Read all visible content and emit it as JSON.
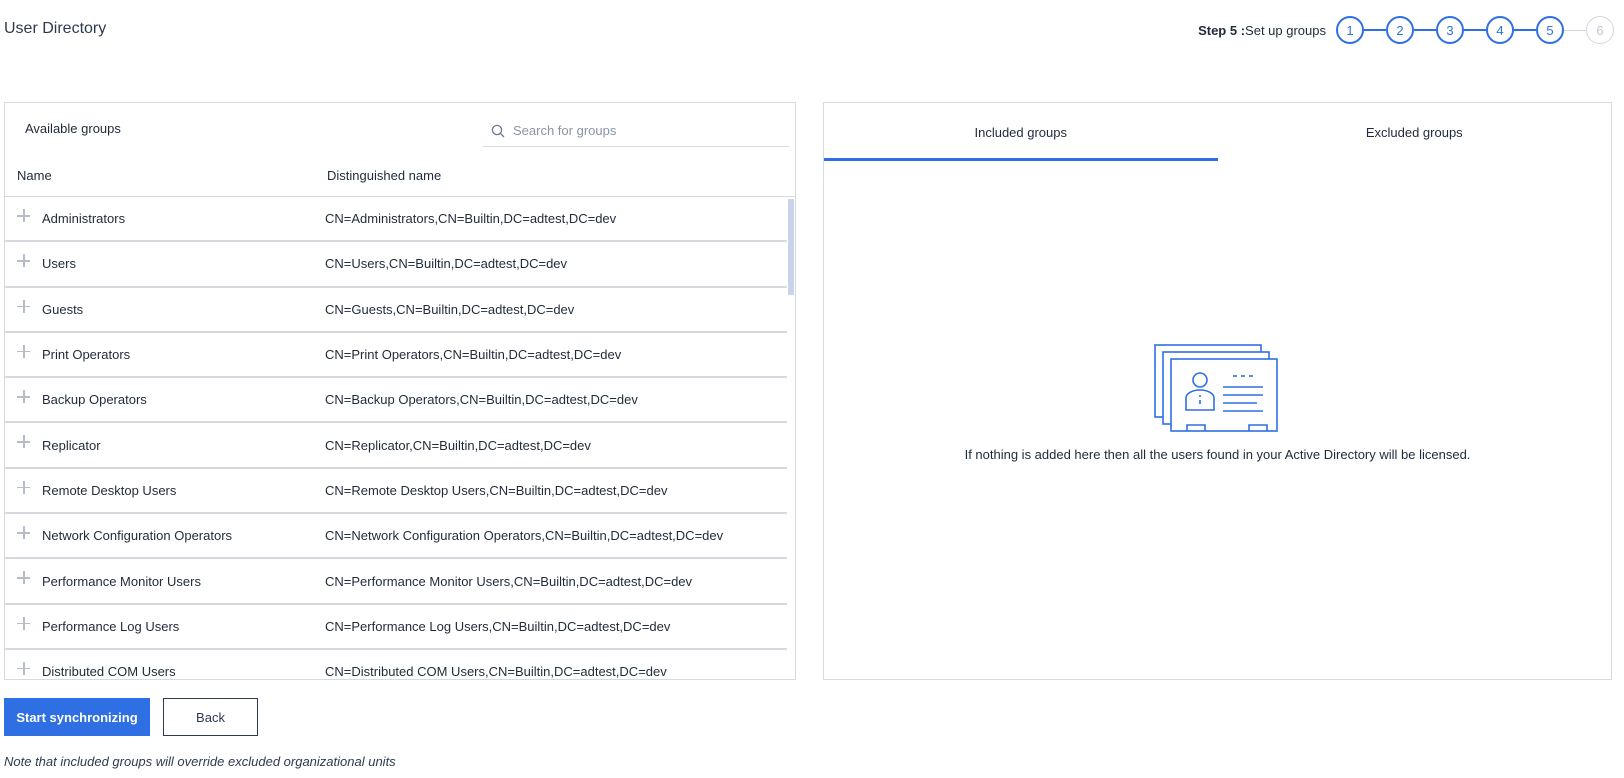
{
  "page": {
    "title": "User Directory"
  },
  "stepper": {
    "prefix": "Step 5 :",
    "label": "Set up groups",
    "steps": [
      "1",
      "2",
      "3",
      "4",
      "5",
      "6"
    ],
    "current": 5
  },
  "available": {
    "title": "Available groups",
    "search_placeholder": "Search for groups",
    "columns": {
      "name": "Name",
      "dn": "Distinguished name"
    },
    "rows": [
      {
        "name": "Administrators",
        "dn": "CN=Administrators,CN=Builtin,DC=adtest,DC=dev"
      },
      {
        "name": "Users",
        "dn": "CN=Users,CN=Builtin,DC=adtest,DC=dev"
      },
      {
        "name": "Guests",
        "dn": "CN=Guests,CN=Builtin,DC=adtest,DC=dev"
      },
      {
        "name": "Print Operators",
        "dn": "CN=Print Operators,CN=Builtin,DC=adtest,DC=dev"
      },
      {
        "name": "Backup Operators",
        "dn": "CN=Backup Operators,CN=Builtin,DC=adtest,DC=dev"
      },
      {
        "name": "Replicator",
        "dn": "CN=Replicator,CN=Builtin,DC=adtest,DC=dev"
      },
      {
        "name": "Remote Desktop Users",
        "dn": "CN=Remote Desktop Users,CN=Builtin,DC=adtest,DC=dev"
      },
      {
        "name": "Network Configuration Operators",
        "dn": "CN=Network Configuration Operators,CN=Builtin,DC=adtest,DC=dev"
      },
      {
        "name": "Performance Monitor Users",
        "dn": "CN=Performance Monitor Users,CN=Builtin,DC=adtest,DC=dev"
      },
      {
        "name": "Performance Log Users",
        "dn": "CN=Performance Log Users,CN=Builtin,DC=adtest,DC=dev"
      },
      {
        "name": "Distributed COM Users",
        "dn": "CN=Distributed COM Users,CN=Builtin,DC=adtest,DC=dev"
      }
    ]
  },
  "selection": {
    "tabs": {
      "included": "Included groups",
      "excluded": "Excluded groups"
    },
    "active_tab": "included",
    "empty_message": "If nothing is added here then all the users found in your Active Directory will be licensed."
  },
  "actions": {
    "start_label": "Start synchronizing",
    "back_label": "Back"
  },
  "note": "Note that included groups will override excluded organizational units",
  "colors": {
    "accent": "#2f6fe4",
    "border": "#d6dae0",
    "disabled": "#d2d6dc"
  }
}
